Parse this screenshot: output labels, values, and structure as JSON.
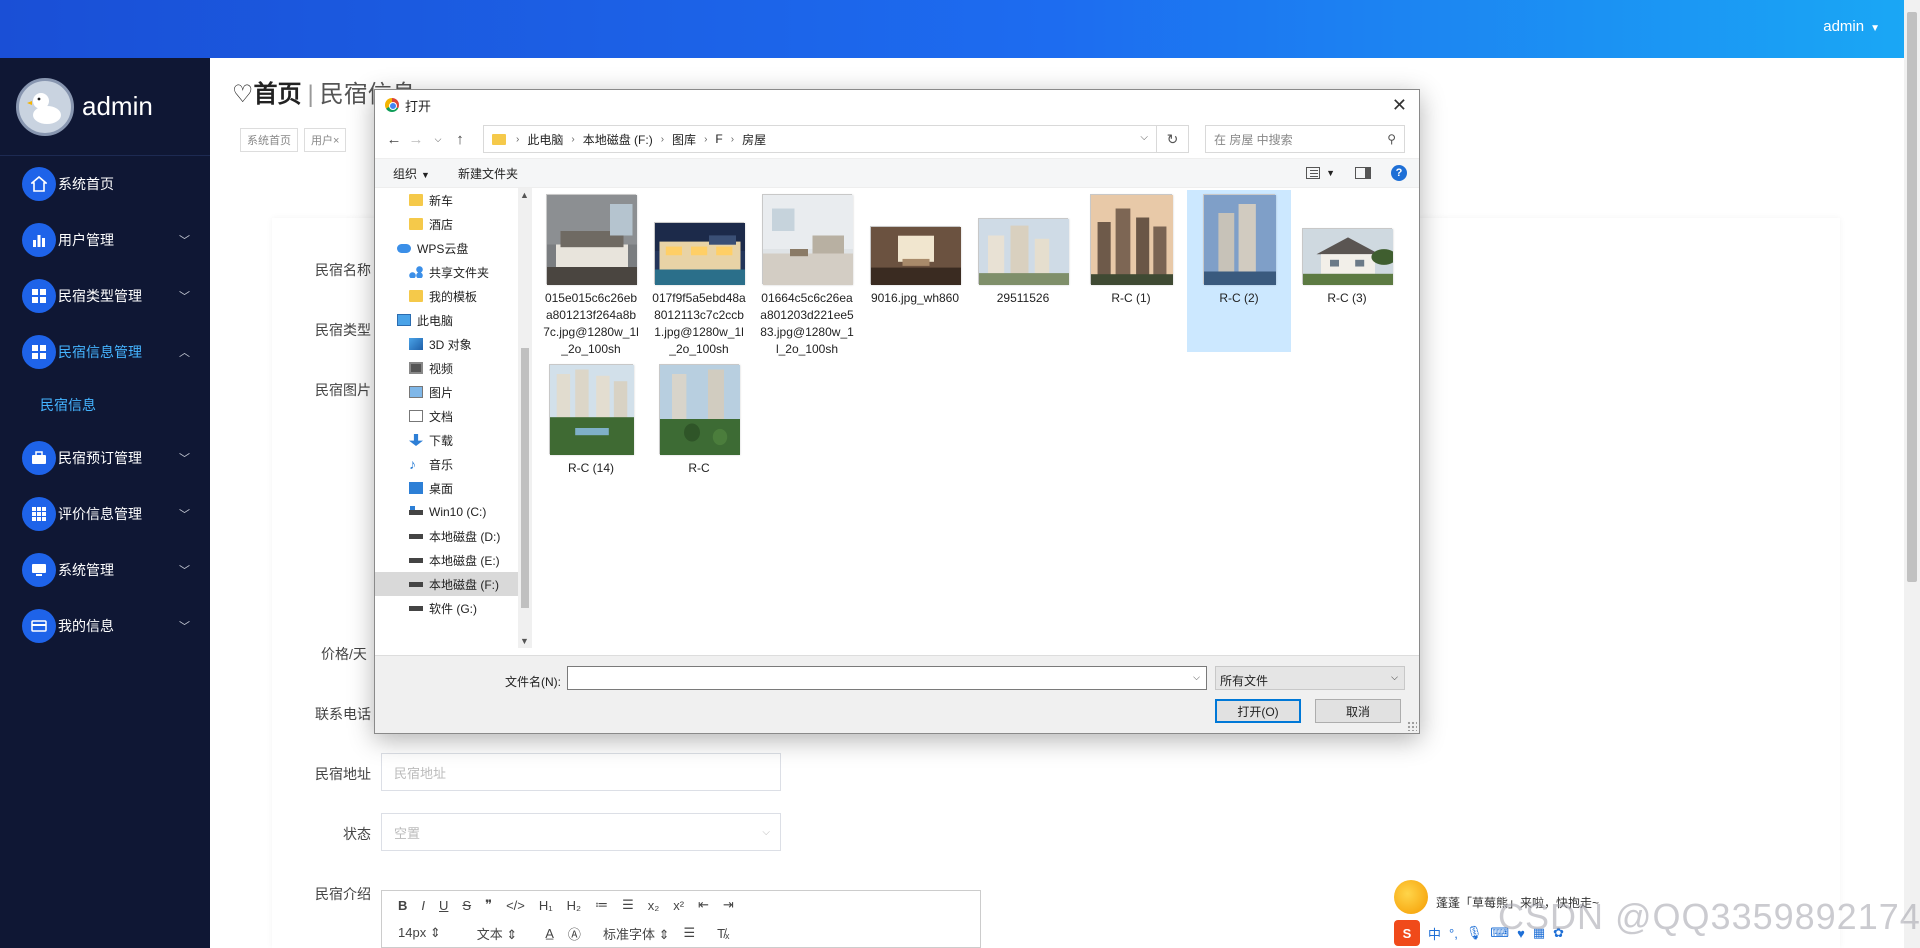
{
  "topbar": {
    "user": "admin"
  },
  "sidebar": {
    "brand": "admin",
    "items": [
      {
        "label": "系统首页",
        "icon": "home-icon",
        "has_children": false
      },
      {
        "label": "用户管理",
        "icon": "bar-chart-icon",
        "has_children": true
      },
      {
        "label": "民宿类型管理",
        "icon": "grid-icon",
        "has_children": true
      },
      {
        "label": "民宿信息管理",
        "icon": "grid-icon",
        "has_children": true,
        "expanded": true
      },
      {
        "label": "民宿预订管理",
        "icon": "briefcase-icon",
        "has_children": true
      },
      {
        "label": "评价信息管理",
        "icon": "table-icon",
        "has_children": true
      },
      {
        "label": "系统管理",
        "icon": "monitor-icon",
        "has_children": true
      },
      {
        "label": "我的信息",
        "icon": "card-icon",
        "has_children": true
      }
    ],
    "submenu": {
      "label": "民宿信息"
    }
  },
  "page": {
    "breadcrumb_home": "首页",
    "breadcrumb_current": "民宿信息",
    "tags": [
      "系统首页",
      "用户×"
    ],
    "form": {
      "labels": {
        "name": "民宿名称",
        "type": "民宿类型",
        "image": "民宿图片",
        "price": "价格/天",
        "phone": "联系电话",
        "address": "民宿地址",
        "status": "状态",
        "intro": "民宿介绍"
      },
      "address_placeholder": "民宿地址",
      "status_value": "空置"
    },
    "editor": {
      "row1": [
        "B",
        "I",
        "U",
        "S",
        "❞",
        "</>",
        "H₁",
        "H₂",
        "≔",
        "☰",
        "x₂",
        "x²",
        "⇤",
        "⇥"
      ],
      "font_size": "14px",
      "block_type": "文本",
      "font_family": "标准字体"
    }
  },
  "dialog": {
    "title": "打开",
    "path": [
      "此电脑",
      "本地磁盘 (F:)",
      "图库",
      "F",
      "房屋"
    ],
    "search_placeholder": "在 房屋 中搜索",
    "toolbar": {
      "organize": "组织",
      "new_folder": "新建文件夹"
    },
    "nav": [
      {
        "label": "新车",
        "icon": "folder-icon",
        "indent": 1
      },
      {
        "label": "酒店",
        "icon": "folder-icon",
        "indent": 1
      },
      {
        "label": "WPS云盘",
        "icon": "cloud-icon",
        "indent": 0
      },
      {
        "label": "共享文件夹",
        "icon": "share-icon",
        "indent": 1
      },
      {
        "label": "我的模板",
        "icon": "folder-icon",
        "indent": 1
      },
      {
        "label": "此电脑",
        "icon": "pc-icon",
        "indent": 0
      },
      {
        "label": "3D 对象",
        "icon": "cube-icon",
        "indent": 1
      },
      {
        "label": "视频",
        "icon": "video-icon",
        "indent": 1
      },
      {
        "label": "图片",
        "icon": "picture-icon",
        "indent": 1
      },
      {
        "label": "文档",
        "icon": "document-icon",
        "indent": 1
      },
      {
        "label": "下载",
        "icon": "download-icon",
        "indent": 1
      },
      {
        "label": "音乐",
        "icon": "music-icon",
        "indent": 1
      },
      {
        "label": "桌面",
        "icon": "desktop-icon",
        "indent": 1
      },
      {
        "label": "Win10 (C:)",
        "icon": "windows-drive-icon",
        "indent": 1
      },
      {
        "label": "本地磁盘 (D:)",
        "icon": "drive-icon",
        "indent": 1
      },
      {
        "label": "本地磁盘 (E:)",
        "icon": "drive-icon",
        "indent": 1
      },
      {
        "label": "本地磁盘 (F:)",
        "icon": "drive-icon",
        "indent": 1,
        "selected": true
      },
      {
        "label": "软件 (G:)",
        "icon": "drive-icon",
        "indent": 1
      }
    ],
    "files": [
      {
        "name": "015e015c6c26eba801213f264a8b7c.jpg@1280w_1l_2o_100sh",
        "theme": "bedroom"
      },
      {
        "name": "017f9f5a5ebd48a8012113c7c2ccb1.jpg@1280w_1l_2o_100sh",
        "theme": "villa-night"
      },
      {
        "name": "01664c5c6c26eaa801203d221ee583.jpg@1280w_1l_2o_100sh",
        "theme": "living-room"
      },
      {
        "name": "9016.jpg_wh860",
        "theme": "interior-warm"
      },
      {
        "name": "29511526",
        "theme": "towers-day"
      },
      {
        "name": "R-C (1)",
        "theme": "towers-dusk"
      },
      {
        "name": "R-C (2)",
        "theme": "tower-blue",
        "selected": true
      },
      {
        "name": "R-C (3)",
        "theme": "cottage"
      },
      {
        "name": "R-C (14)",
        "theme": "estate-green"
      },
      {
        "name": "R-C",
        "theme": "estate-garden"
      }
    ],
    "filename_label": "文件名(N):",
    "filename_value": "",
    "filetype": "所有文件",
    "open_label": "打开(O)",
    "cancel_label": "取消"
  },
  "ime": {
    "message": "蓬蓬「草莓熊」来啦，快抱走~",
    "chinese": "中"
  },
  "watermark": "CSDN @QQ3359892174"
}
